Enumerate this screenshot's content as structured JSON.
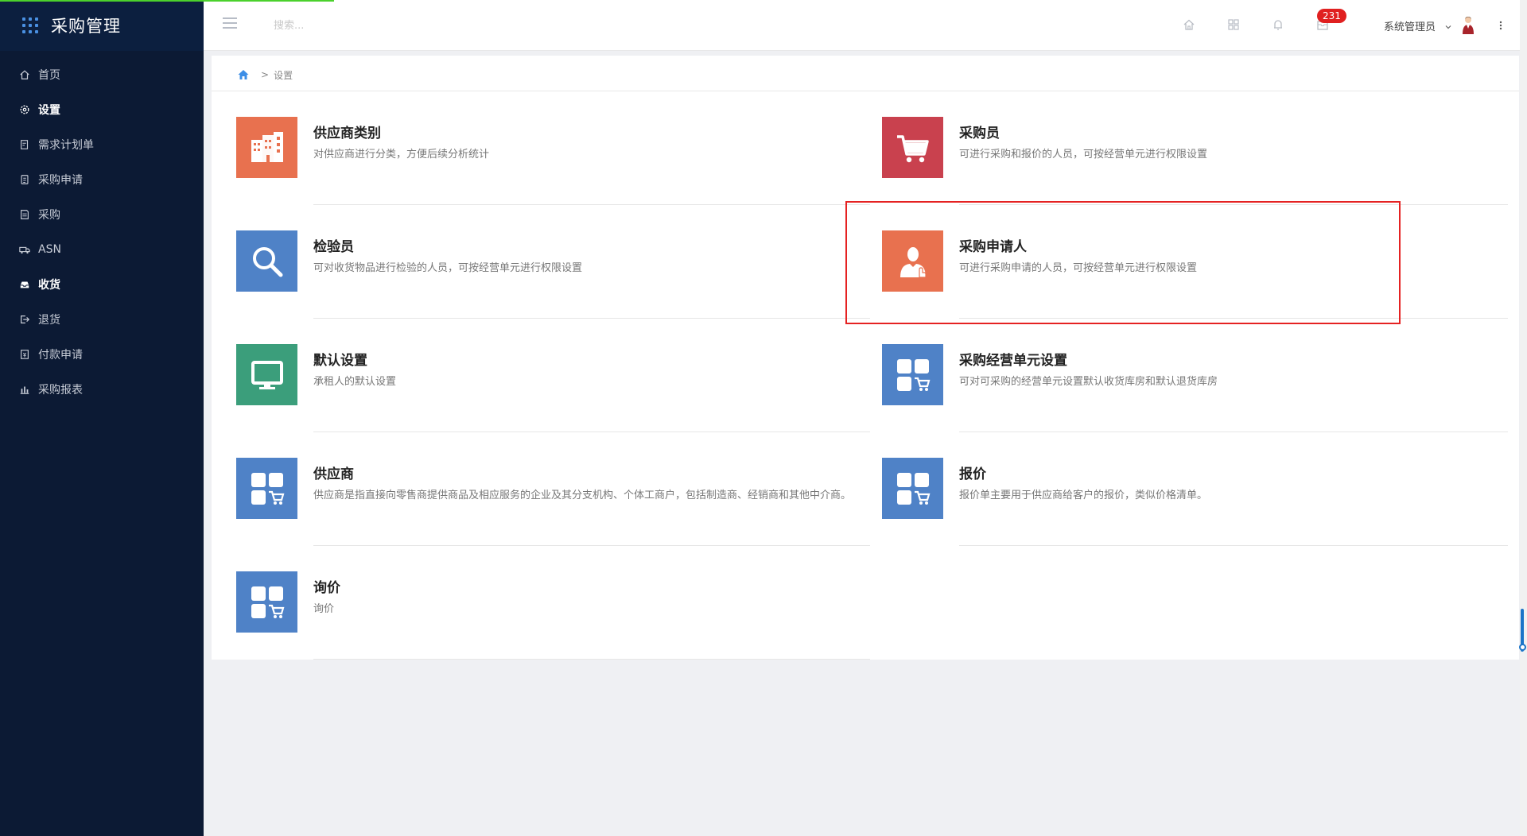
{
  "app": {
    "title": "采购管理"
  },
  "sidebar": {
    "items": [
      {
        "label": "首页",
        "icon": "home-icon",
        "active": false
      },
      {
        "label": "设置",
        "icon": "gear-icon",
        "active": true
      },
      {
        "label": "需求计划单",
        "icon": "document-edit-icon",
        "active": false
      },
      {
        "label": "采购申请",
        "icon": "clipboard-icon",
        "active": false
      },
      {
        "label": "采购",
        "icon": "list-document-icon",
        "active": false
      },
      {
        "label": "ASN",
        "icon": "truck-icon",
        "active": false
      },
      {
        "label": "收货",
        "icon": "inbox-icon",
        "active": false
      },
      {
        "label": "退货",
        "icon": "return-icon",
        "active": false
      },
      {
        "label": "付款申请",
        "icon": "payment-icon",
        "active": false
      },
      {
        "label": "采购报表",
        "icon": "bar-chart-icon",
        "active": false
      }
    ]
  },
  "header": {
    "search_placeholder": "搜索...",
    "notification_count": "231",
    "user_name": "系统管理员"
  },
  "breadcrumb": {
    "separator": ">",
    "current": "设置"
  },
  "cards": [
    {
      "title": "供应商类别",
      "desc": "对供应商进行分类，方便后续分析统计",
      "icon": "building-icon",
      "color": "#e8714f"
    },
    {
      "title": "采购员",
      "desc": "可进行采购和报价的人员，可按经营单元进行权限设置",
      "icon": "cart-icon",
      "color": "#c9414e"
    },
    {
      "title": "检验员",
      "desc": "可对收货物品进行检验的人员，可按经营单元进行权限设置",
      "icon": "magnifier-icon",
      "color": "#4f82c7"
    },
    {
      "title": "采购申请人",
      "desc": "可进行采购申请的人员，可按经营单元进行权限设置",
      "icon": "person-icon",
      "color": "#e8714f"
    },
    {
      "title": "默认设置",
      "desc": "承租人的默认设置",
      "icon": "monitor-icon",
      "color": "#3b9e7b"
    },
    {
      "title": "采购经营单元设置",
      "desc": "可对可采购的经营单元设置默认收货库房和默认退货库房",
      "icon": "apps-cart-icon",
      "color": "#4f82c7"
    },
    {
      "title": "供应商",
      "desc": "供应商是指直接向零售商提供商品及相应服务的企业及其分支机构、个体工商户，包括制造商、经销商和其他中介商。",
      "icon": "apps-cart-icon",
      "color": "#4f82c7"
    },
    {
      "title": "报价",
      "desc": "报价单主要用于供应商给客户的报价，类似价格清单。",
      "icon": "apps-cart-icon",
      "color": "#4f82c7"
    },
    {
      "title": "询价",
      "desc": "询价",
      "icon": "apps-cart-icon",
      "color": "#4f82c7"
    }
  ],
  "colors": {
    "sidebar_bg": "#0c1a34",
    "highlight": "#e52222",
    "badge": "#e02020"
  }
}
